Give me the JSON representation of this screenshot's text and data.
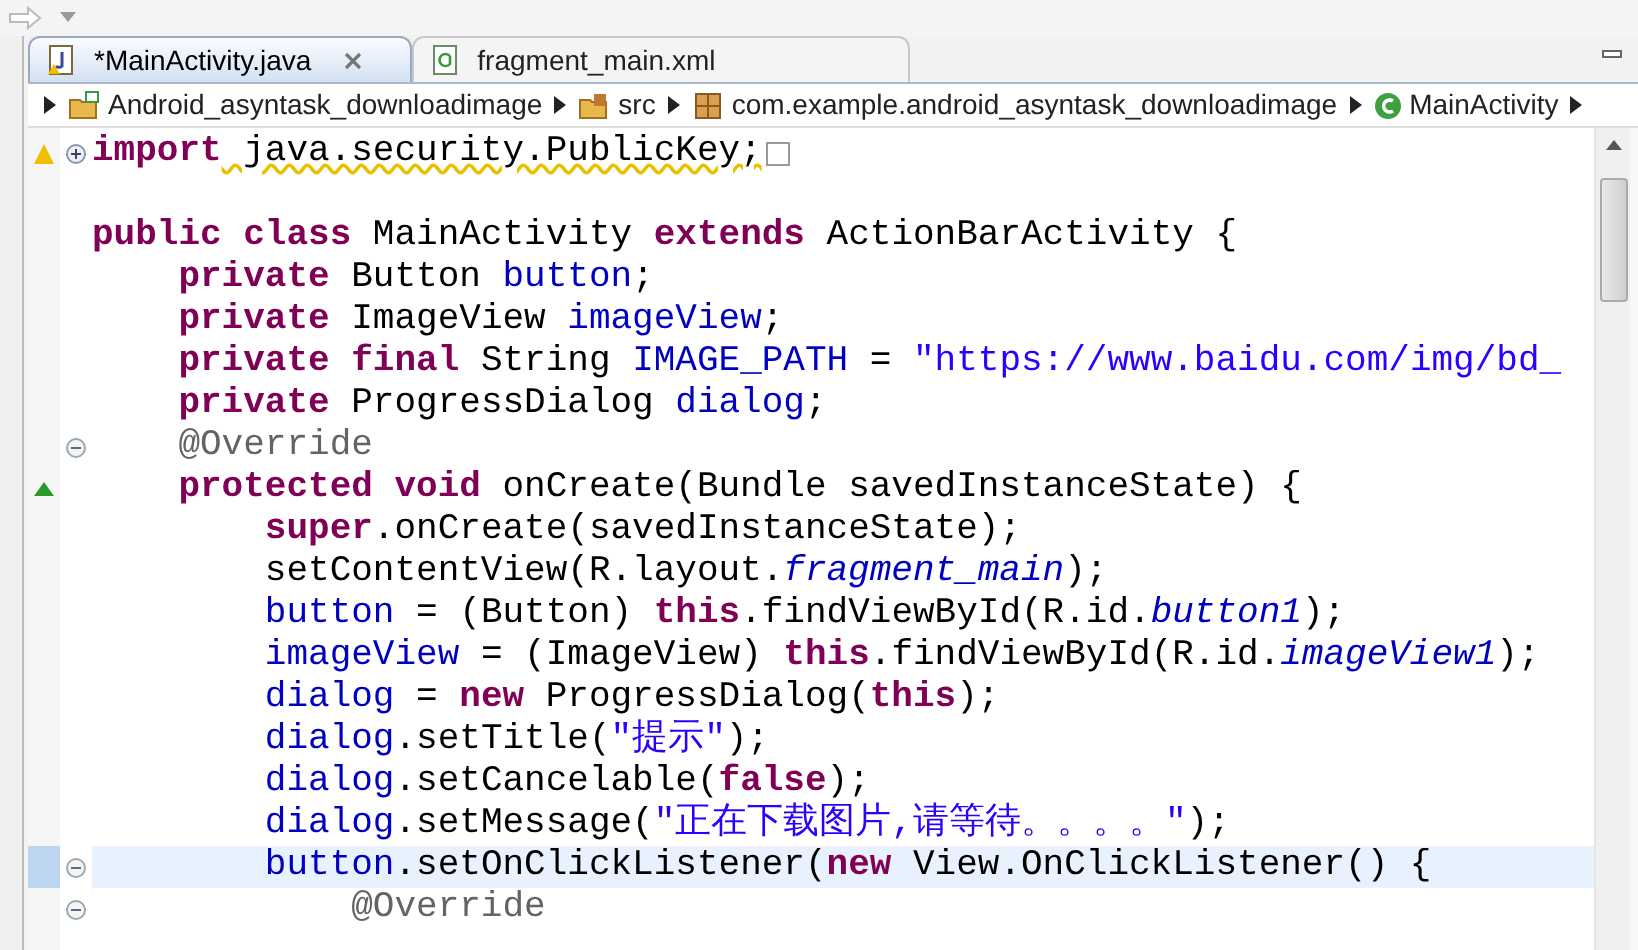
{
  "tabs": [
    {
      "label": "*MainActivity.java",
      "selected": true,
      "kind": "java"
    },
    {
      "label": "fragment_main.xml",
      "selected": false,
      "kind": "xml"
    }
  ],
  "breadcrumb": [
    {
      "label": "Android_asyntask_downloadimage",
      "kind": "project"
    },
    {
      "label": "src",
      "kind": "folder"
    },
    {
      "label": "com.example.android_asyntask_downloadimage",
      "kind": "package"
    },
    {
      "label": "MainActivity",
      "kind": "class"
    }
  ],
  "editor": {
    "lines": [
      {
        "collapsed": true,
        "current": false,
        "tokens": [
          {
            "kind": "keyword",
            "text": "import"
          },
          {
            "kind": "warning",
            "text": " java.security.PublicKey;"
          }
        ]
      },
      {
        "current": false
      },
      {
        "current": false,
        "tokens": [
          {
            "kind": "keyword",
            "text": "public class"
          },
          {
            "kind": "plain",
            "text": " MainActivity "
          },
          {
            "kind": "keyword",
            "text": "extends"
          },
          {
            "kind": "plain",
            "text": " ActionBarActivity {"
          }
        ]
      },
      {
        "current": false,
        "tokens": [
          {
            "kind": "keyword",
            "text": "    private"
          },
          {
            "kind": "plain",
            "text": " Button "
          },
          {
            "kind": "field",
            "text": "button"
          },
          {
            "kind": "plain",
            "text": ";"
          }
        ]
      },
      {
        "current": false,
        "tokens": [
          {
            "kind": "keyword",
            "text": "    private"
          },
          {
            "kind": "plain",
            "text": " ImageView "
          },
          {
            "kind": "field",
            "text": "imageView"
          },
          {
            "kind": "plain",
            "text": ";"
          }
        ]
      },
      {
        "current": false,
        "tokens": [
          {
            "kind": "keyword",
            "text": "    private final"
          },
          {
            "kind": "plain",
            "text": " String "
          },
          {
            "kind": "field",
            "text": "IMAGE_PATH"
          },
          {
            "kind": "plain",
            "text": " = "
          },
          {
            "kind": "string",
            "text": "\"https://www.baidu.com/img/bd_"
          }
        ]
      },
      {
        "current": false,
        "tokens": [
          {
            "kind": "keyword",
            "text": "    private"
          },
          {
            "kind": "plain",
            "text": " ProgressDialog "
          },
          {
            "kind": "field",
            "text": "dialog"
          },
          {
            "kind": "plain",
            "text": ";"
          }
        ]
      },
      {
        "collapsed": false,
        "current": false,
        "tokens": [
          {
            "kind": "annotation",
            "text": "    @Override"
          }
        ]
      },
      {
        "current": false,
        "tokens": [
          {
            "kind": "keyword",
            "text": "    protected void"
          },
          {
            "kind": "plain",
            "text": " onCreate(Bundle savedInstanceState) {"
          }
        ]
      },
      {
        "current": false,
        "tokens": [
          {
            "kind": "keyword",
            "text": "        super"
          },
          {
            "kind": "plain",
            "text": ".onCreate(savedInstanceState);"
          }
        ]
      },
      {
        "current": false,
        "tokens": [
          {
            "kind": "plain",
            "text": "        setContentView(R.layout."
          },
          {
            "kind": "static",
            "text": "fragment_main"
          },
          {
            "kind": "plain",
            "text": ");"
          }
        ]
      },
      {
        "current": false,
        "tokens": [
          {
            "kind": "field",
            "text": "        button"
          },
          {
            "kind": "plain",
            "text": " = (Button) "
          },
          {
            "kind": "keyword",
            "text": "this"
          },
          {
            "kind": "plain",
            "text": ".findViewById(R.id."
          },
          {
            "kind": "static",
            "text": "button1"
          },
          {
            "kind": "plain",
            "text": ");"
          }
        ]
      },
      {
        "current": false,
        "tokens": [
          {
            "kind": "field",
            "text": "        imageView"
          },
          {
            "kind": "plain",
            "text": " = (ImageView) "
          },
          {
            "kind": "keyword",
            "text": "this"
          },
          {
            "kind": "plain",
            "text": ".findViewById(R.id."
          },
          {
            "kind": "static",
            "text": "imageView1"
          },
          {
            "kind": "plain",
            "text": ");"
          }
        ]
      },
      {
        "current": false,
        "tokens": [
          {
            "kind": "field",
            "text": "        dialog"
          },
          {
            "kind": "plain",
            "text": " = "
          },
          {
            "kind": "keyword",
            "text": "new"
          },
          {
            "kind": "plain",
            "text": " ProgressDialog("
          },
          {
            "kind": "keyword",
            "text": "this"
          },
          {
            "kind": "plain",
            "text": ");"
          }
        ]
      },
      {
        "current": false,
        "tokens": [
          {
            "kind": "field",
            "text": "        dialog"
          },
          {
            "kind": "plain",
            "text": ".setTitle("
          },
          {
            "kind": "string",
            "text": "\"提示\""
          },
          {
            "kind": "plain",
            "text": ");"
          }
        ]
      },
      {
        "current": false,
        "tokens": [
          {
            "kind": "field",
            "text": "        dialog"
          },
          {
            "kind": "plain",
            "text": ".setCancelable("
          },
          {
            "kind": "keyword",
            "text": "false"
          },
          {
            "kind": "plain",
            "text": ");"
          }
        ]
      },
      {
        "current": false,
        "tokens": [
          {
            "kind": "field",
            "text": "        dialog"
          },
          {
            "kind": "plain",
            "text": ".setMessage("
          },
          {
            "kind": "string",
            "text": "\"正在下载图片,请等待。。。。\""
          },
          {
            "kind": "plain",
            "text": ");"
          }
        ]
      },
      {
        "collapsed": false,
        "current": true,
        "tokens": [
          {
            "kind": "field",
            "text": "        button"
          },
          {
            "kind": "plain",
            "text": ".setOnClickListener("
          },
          {
            "kind": "keyword",
            "text": "new"
          },
          {
            "kind": "plain",
            "text": " View.OnClickListener() {"
          }
        ]
      },
      {
        "collapsed": false,
        "current": false,
        "tokens": [
          {
            "kind": "annotation",
            "text": "            @Override"
          }
        ]
      }
    ]
  }
}
